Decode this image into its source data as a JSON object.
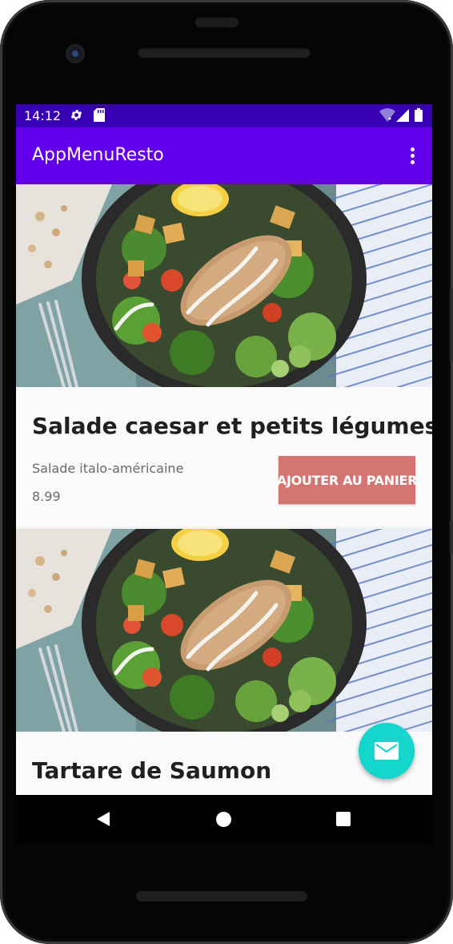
{
  "status_bar": {
    "time": "14:12",
    "icons": [
      "settings-icon",
      "sd-card-icon",
      "wifi-icon",
      "signal-icon",
      "battery-icon"
    ]
  },
  "app_bar": {
    "title": "AppMenuResto",
    "overflow_icon": "more-vert-icon"
  },
  "menu_items": [
    {
      "title": "Salade caesar et petits légumes",
      "description": "Salade italo-américaine",
      "price": "8.99",
      "button_label": "AJOUTER AU PANIER"
    },
    {
      "title": "Tartare de Saumon"
    }
  ],
  "fab": {
    "icon": "email-icon"
  },
  "nav_bar": {
    "icons": [
      "back-icon",
      "home-icon",
      "recents-icon"
    ]
  },
  "colors": {
    "status_bar": "#3700b3",
    "app_bar": "#6200ee",
    "add_button": "#d57572",
    "fab": "#14d6cc"
  }
}
